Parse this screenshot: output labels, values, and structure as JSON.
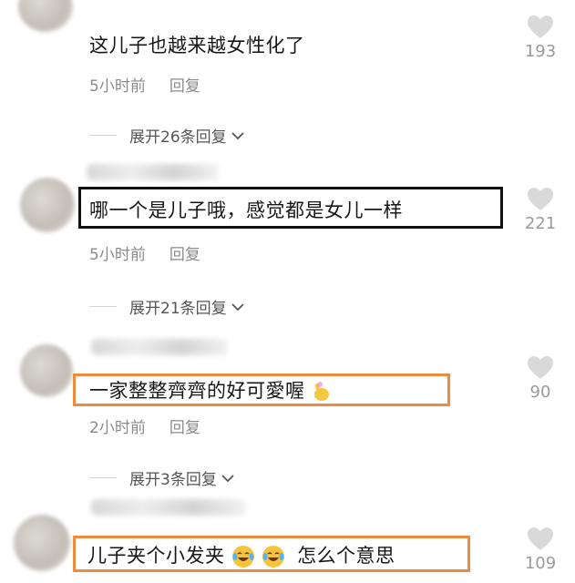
{
  "comments": [
    {
      "text": "这儿子也越来越女性化了",
      "time": "5小时前",
      "reply": "回复",
      "likes": "193",
      "expand": "展开26条回复"
    },
    {
      "text": "哪一个是儿子哦，感觉都是女儿一样",
      "time": "5小时前",
      "reply": "回复",
      "likes": "221",
      "expand": "展开21条回复"
    },
    {
      "text": "一家整整齊齊的好可愛喔",
      "time": "2小时前",
      "reply": "回复",
      "likes": "90",
      "expand": "展开3条回复"
    },
    {
      "text_a": "儿子夹个小发夹",
      "text_b": "怎么个意思",
      "likes": "109"
    }
  ],
  "highlight_colors": {
    "black": "#111111",
    "orange": "#f08a3e"
  },
  "icons": [
    "heart-icon",
    "chevron-down-icon",
    "finger-emoji-icon",
    "crying-laugh-emoji-icon"
  ]
}
